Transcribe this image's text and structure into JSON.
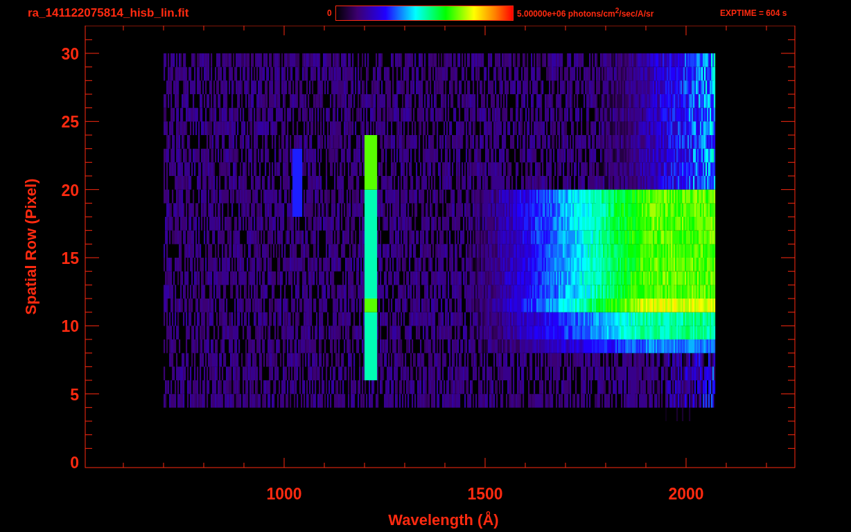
{
  "file_name": "ra_141122075814_hisb_lin.fit",
  "colorbar": {
    "min_label": "0",
    "max_label": "5.00000e+06 photons/cm$^{2}$/sec/A/sr"
  },
  "exposure": "EXPTIME = 604 s",
  "plot": {
    "xlabel": "Wavelength (Å)",
    "ylabel": "Spatial Row (Pixel)",
    "xticks": [
      "1000",
      "1500",
      "2000"
    ],
    "yticks": [
      "30",
      "25",
      "20",
      "15",
      "10",
      "5",
      "0"
    ]
  }
}
